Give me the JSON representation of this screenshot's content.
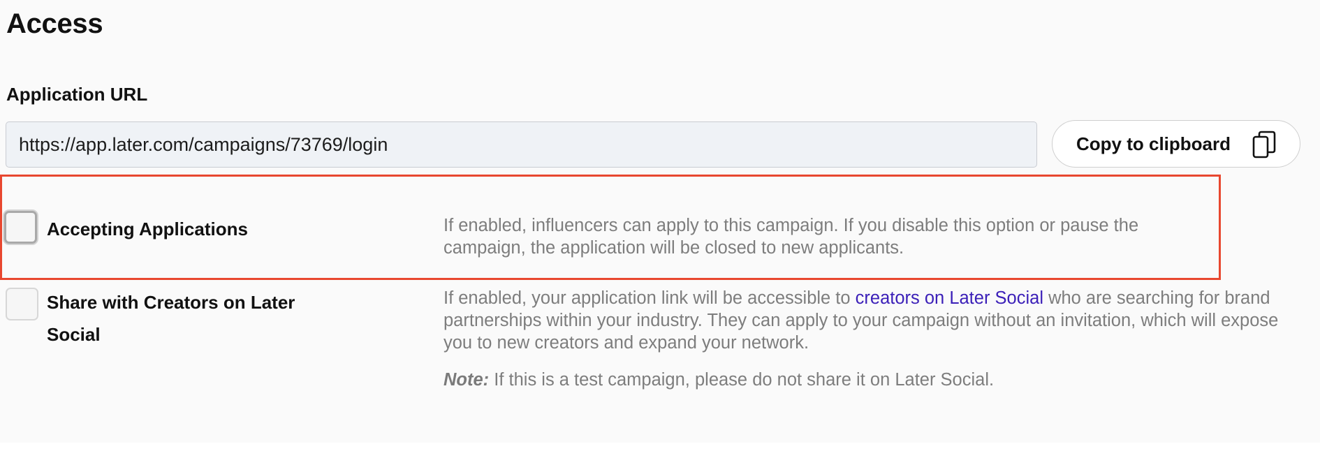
{
  "access": {
    "title": "Access",
    "application_url": {
      "label": "Application URL",
      "value": "https://app.later.com/campaigns/73769/login"
    },
    "copy_button": {
      "label": "Copy to clipboard",
      "icon": "copy-icon"
    }
  },
  "options": [
    {
      "label": "Accepting Applications",
      "checked": false,
      "description": "If enabled, influencers can apply to this campaign. If you disable this option or pause the campaign, the application will be closed to new applicants."
    },
    {
      "label_line1": "Share with Creators on Later",
      "label_line2": "Social",
      "checked": false,
      "description_before_link": "If enabled, your application link will be accessible to ",
      "link_text": "creators on Later Social",
      "description_after_link": " who are searching for brand partnerships within your industry. They can apply to your campaign without an invitation, which will expose you to new creators and expand your network.",
      "note_label": "Note:",
      "note_text": " If this is a test campaign, please do not share it on Later Social."
    }
  ],
  "colors": {
    "highlight_border": "#e8472f",
    "link": "#3b1fb8",
    "input_bg": "#eff2f6"
  }
}
